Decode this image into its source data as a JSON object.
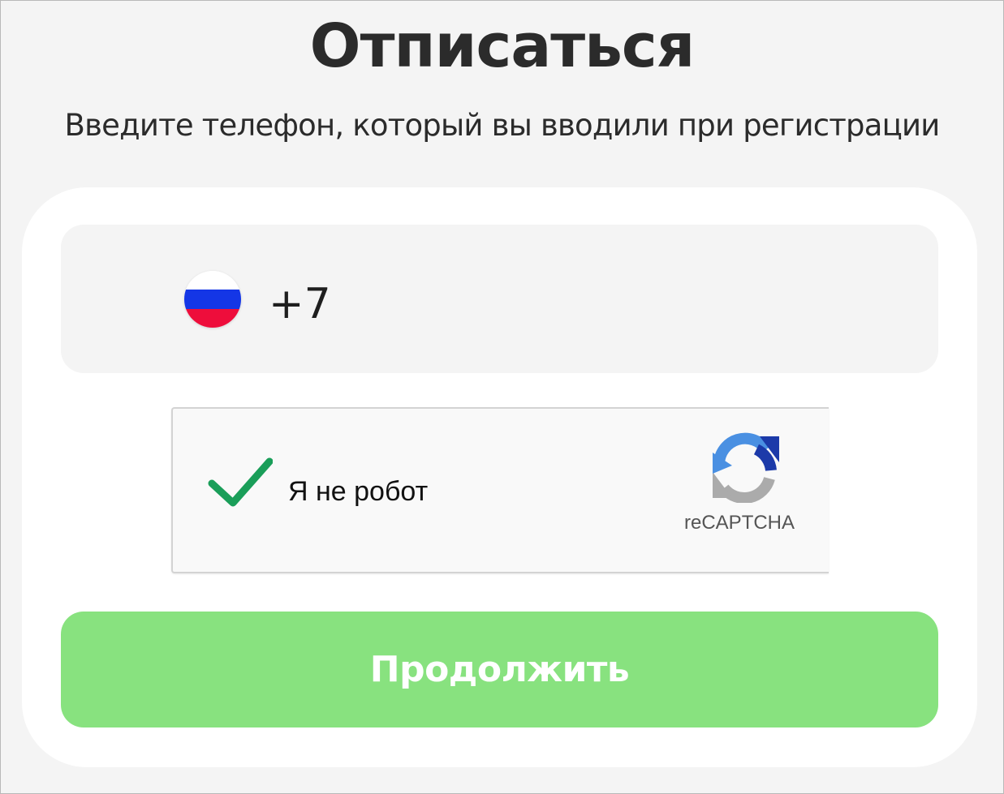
{
  "page": {
    "title": "Отписаться",
    "subtitle": "Введите телефон, который вы вводили при регистрации"
  },
  "phone": {
    "country_flag_icon": "russia-flag-icon",
    "prefix": "+7"
  },
  "captcha": {
    "status": "checked",
    "label": "Я не робот",
    "brand": "reCAPTCHA",
    "check_icon": "checkmark-icon",
    "logo_icon": "recaptcha-logo-icon"
  },
  "actions": {
    "continue_label": "Продолжить"
  },
  "colors": {
    "page_background": "#f4f4f4",
    "card_background": "#ffffff",
    "field_background": "#f4f4f4",
    "button_background": "#88e27f",
    "check_color": "#1a9e59",
    "text_color": "#2b2b2b"
  }
}
